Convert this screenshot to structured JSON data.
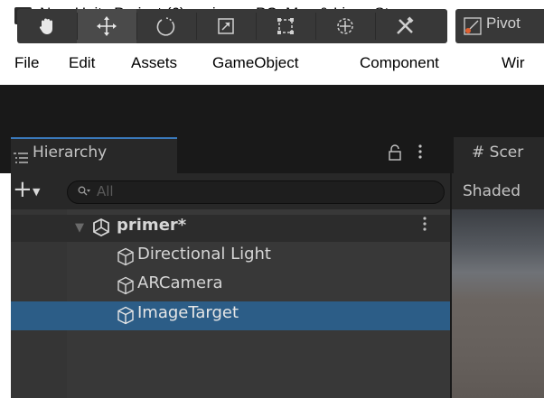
{
  "window": {
    "title": "New Unity Project (6) - primer - PC, Mac & Linux Sta",
    "icon": "unity-logo-icon"
  },
  "menu": [
    "File",
    "Edit",
    "Assets",
    "GameObject",
    "Component",
    "Wir"
  ],
  "toolbar": {
    "tools": [
      "hand-tool-icon",
      "move-tool-icon",
      "rotate-tool-icon",
      "scale-tool-icon",
      "rect-tool-icon",
      "transform-tool-icon",
      "custom-tool-icon"
    ],
    "active_tool": "move-tool-icon",
    "pivot_label": "Pivot"
  },
  "hierarchy": {
    "tab_label": "Hierarchy",
    "search_placeholder": "All",
    "scene_name": "primer*",
    "items": [
      {
        "label": "Directional Light",
        "selected": false
      },
      {
        "label": "ARCamera",
        "selected": false
      },
      {
        "label": "ImageTarget",
        "selected": true
      }
    ]
  },
  "scene_view": {
    "tab_label": "# Scer",
    "shading_label": "Shaded"
  },
  "colors": {
    "toolbar_bg": "#191919",
    "panel_bg": "#383838",
    "selection": "#2c5d87",
    "tab_accent": "#3a79bb"
  }
}
